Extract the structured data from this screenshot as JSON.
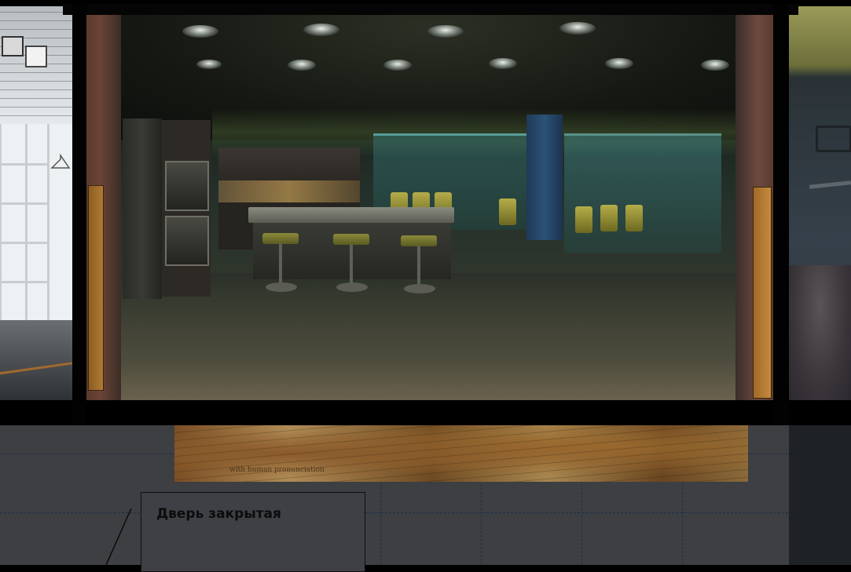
{
  "scene": {
    "main_room": "kitchen-dining-room",
    "left_room": "storage-room",
    "right_room": "corridor"
  },
  "parchment": {
    "note": "with human pronunciation"
  },
  "tooltip": {
    "text": "Дверь закрытая"
  },
  "colors": {
    "wall": "#000000",
    "lower_floor": "#3d3f43",
    "grid_line": "#1f2f45",
    "tooltip_text": "#0c0c0c",
    "door": "#b07a34"
  }
}
